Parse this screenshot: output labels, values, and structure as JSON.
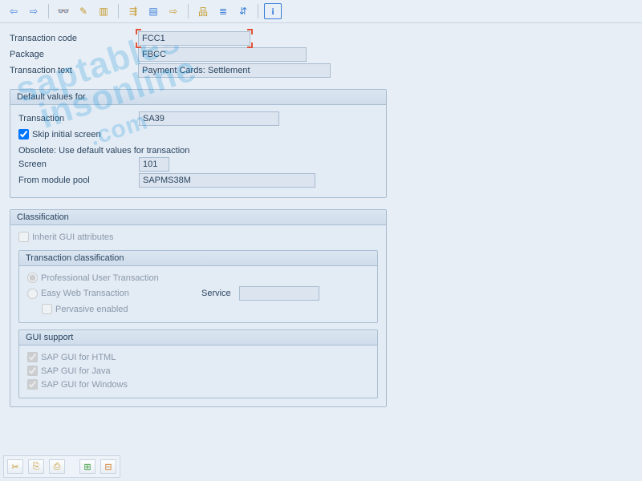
{
  "toolbar": {
    "icons": [
      "⇦",
      "⇨",
      "spec",
      "+⊞",
      "+⊟",
      "≣⇨",
      "品",
      "≣",
      "⇵",
      "ℹ"
    ]
  },
  "header": {
    "tcode_label": "Transaction code",
    "tcode_value": "FCC1",
    "package_label": "Package",
    "package_value": "FBCC",
    "ttext_label": "Transaction text",
    "ttext_value": "Payment Cards: Settlement"
  },
  "defaults": {
    "title": "Default values for",
    "transaction_label": "Transaction",
    "transaction_value": "SA39",
    "skip_label": "Skip initial screen",
    "skip_checked": true,
    "obsolete_note": "Obsolete: Use default values for transaction",
    "screen_label": "Screen",
    "screen_value": "101",
    "pool_label": "From module pool",
    "pool_value": "SAPMS38M"
  },
  "classification": {
    "title": "Classification",
    "inherit_label": "Inherit GUI attributes",
    "inherit_checked": false,
    "tc_title": "Transaction classification",
    "prof_label": "Professional User Transaction",
    "easy_label": "Easy Web Transaction",
    "service_label": "Service",
    "service_value": "",
    "pervasive_label": "Pervasive enabled",
    "gui_title": "GUI support",
    "gui_html_label": "SAP GUI for HTML",
    "gui_java_label": "SAP GUI for Java",
    "gui_win_label": "SAP GUI for Windows"
  },
  "footer": {
    "icons": [
      "✂",
      "⎘",
      "⎙",
      "⊞",
      "⊟"
    ]
  }
}
